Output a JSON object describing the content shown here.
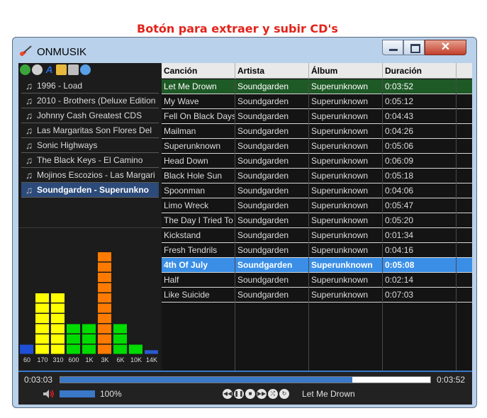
{
  "annotation": "Botón para extraer y subir CD's",
  "window": {
    "title": "ONMUSIK"
  },
  "toolbar": [
    {
      "icon": "add-icon",
      "color": "#3aa53a"
    },
    {
      "icon": "disc-icon",
      "color": "#cfcfcf"
    },
    {
      "icon": "text-icon",
      "color": "#2a6ad8"
    },
    {
      "icon": "folder-icon",
      "color": "#e8b93c"
    },
    {
      "icon": "drive-icon",
      "color": "#bdbdbd"
    },
    {
      "icon": "upload-cd-icon",
      "color": "#5aa0e8"
    }
  ],
  "playlists": [
    {
      "label": "1996 - Load"
    },
    {
      "label": "2010 - Brothers (Deluxe Edition"
    },
    {
      "label": "Johnny Cash Greatest CDS"
    },
    {
      "label": "Las Margaritas Son Flores Del"
    },
    {
      "label": "Sonic Highways"
    },
    {
      "label": "The Black Keys - El Camino"
    },
    {
      "label": "Mojinos Escozios - Las Margari"
    },
    {
      "label": "Soundgarden - Superunkno",
      "selected": true
    }
  ],
  "equalizer": {
    "bands": [
      "60",
      "170",
      "310",
      "600",
      "1K",
      "3K",
      "6K",
      "10K",
      "14K"
    ],
    "levels": [
      1,
      6,
      6,
      3,
      3,
      10,
      3,
      1,
      0.4
    ],
    "colors": [
      "#1f4fd6",
      "#ffff00",
      "#ffff00",
      "#00dc00",
      "#00dc00",
      "#ff7a00",
      "#00dc00",
      "#00dc00",
      "#2a5ad0"
    ]
  },
  "table": {
    "columns": [
      "Canción",
      "Artista",
      "Álbum",
      "Duración"
    ],
    "rows": [
      [
        "Let Me Drown",
        "Soundgarden",
        "Superunknown",
        "0:03:52"
      ],
      [
        "My Wave",
        "Soundgarden",
        "Superunknown",
        "0:05:12"
      ],
      [
        "Fell On Black Days",
        "Soundgarden",
        "Superunknown",
        "0:04:43"
      ],
      [
        "Mailman",
        "Soundgarden",
        "Superunknown",
        "0:04:26"
      ],
      [
        "Superunknown",
        "Soundgarden",
        "Superunknown",
        "0:05:06"
      ],
      [
        "Head Down",
        "Soundgarden",
        "Superunknown",
        "0:06:09"
      ],
      [
        "Black Hole Sun",
        "Soundgarden",
        "Superunknown",
        "0:05:18"
      ],
      [
        "Spoonman",
        "Soundgarden",
        "Superunknown",
        "0:04:06"
      ],
      [
        "Limo Wreck",
        "Soundgarden",
        "Superunknown",
        "0:05:47"
      ],
      [
        "The Day I Tried To",
        "Soundgarden",
        "Superunknown",
        "0:05:20"
      ],
      [
        "Kickstand",
        "Soundgarden",
        "Superunknown",
        "0:01:34"
      ],
      [
        "Fresh Tendrils",
        "Soundgarden",
        "Superunknown",
        "0:04:16"
      ],
      [
        "4th Of July",
        "Soundgarden",
        "Superunknown",
        "0:05:08"
      ],
      [
        "Half",
        "Soundgarden",
        "Superunknown",
        "0:02:14"
      ],
      [
        "Like Suicide",
        "Soundgarden",
        "Superunknown",
        "0:07:03"
      ]
    ],
    "playing_index": 0,
    "selected_index": 12
  },
  "player": {
    "elapsed": "0:03:03",
    "total": "0:03:52",
    "progress": 0.79,
    "volume_label": "100%",
    "volume": 1.0,
    "now_playing": "Let Me Drown",
    "controls": [
      "prev-icon",
      "pause-icon",
      "stop-icon",
      "next-icon",
      "shuffle-icon",
      "repeat-icon"
    ]
  }
}
